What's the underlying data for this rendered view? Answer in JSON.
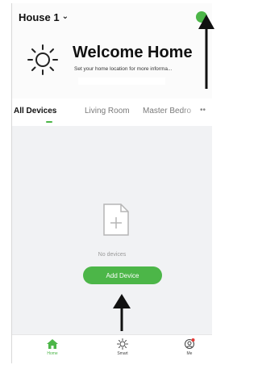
{
  "header": {
    "house_label": "House 1",
    "welcome_title": "Welcome Home",
    "welcome_subtitle": "Set your home location for more informa..."
  },
  "tabs": [
    {
      "label": "All Devices",
      "active": true
    },
    {
      "label": "Living Room",
      "active": false
    },
    {
      "label": "Master Bedro",
      "active": false
    }
  ],
  "tabs_more_label": "••",
  "empty_state": {
    "icon": "document-add-icon",
    "text": "No devices",
    "button_label": "Add Device"
  },
  "bottom_nav": [
    {
      "label": "Home",
      "icon": "home-icon",
      "active": true
    },
    {
      "label": "Smart",
      "icon": "sun-icon",
      "active": false
    },
    {
      "label": "Me",
      "icon": "user-icon",
      "active": false
    }
  ],
  "colors": {
    "accent": "#4cb648",
    "background": "#f1f2f4",
    "notification_dot": "#e53935"
  }
}
